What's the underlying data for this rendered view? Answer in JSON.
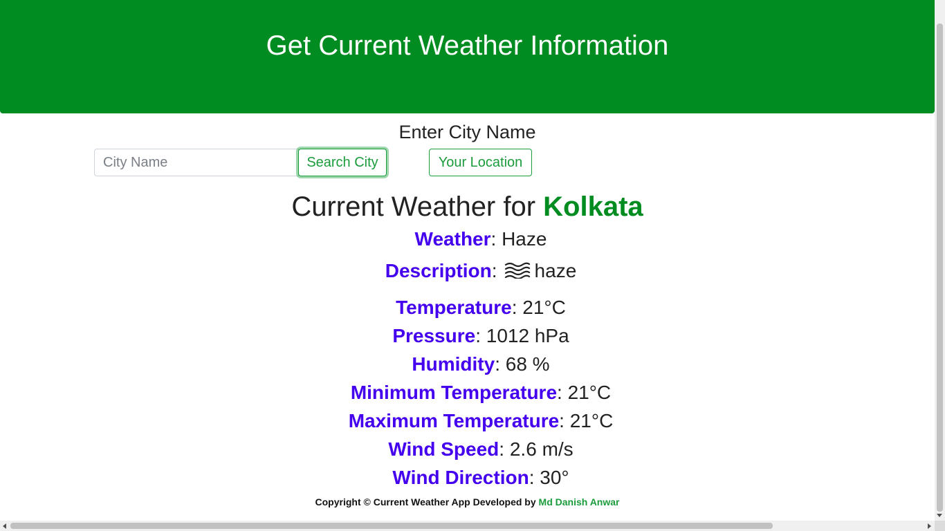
{
  "header": {
    "title": "Get Current Weather Information"
  },
  "search": {
    "heading": "Enter City Name",
    "placeholder": "City Name",
    "search_button": "Search City",
    "location_button": "Your Location"
  },
  "result": {
    "title_prefix": "Current Weather for ",
    "city": "Kolkata",
    "weather": {
      "label": "Weather",
      "value": "Haze"
    },
    "description": {
      "label": "Description",
      "value": "haze",
      "icon": "haze-icon"
    },
    "temperature": {
      "label": "Temperature",
      "value": "21°C"
    },
    "pressure": {
      "label": "Pressure",
      "value": "1012 hPa"
    },
    "humidity": {
      "label": "Humidity",
      "value": "68 %"
    },
    "min_temp": {
      "label": "Minimum Temperature",
      "value": "21°C"
    },
    "max_temp": {
      "label": "Maximum Temperature",
      "value": "21°C"
    },
    "wind_speed": {
      "label": "Wind Speed",
      "value": "2.6 m/s"
    },
    "wind_direction": {
      "label": "Wind Direction",
      "value": "30°"
    }
  },
  "footer": {
    "text": "Copyright © Current Weather App Developed by ",
    "author": "Md Danish Anwar"
  },
  "colors": {
    "header_bg": "#008c20",
    "label": "#4400ee",
    "accent": "#1a9c3c"
  }
}
